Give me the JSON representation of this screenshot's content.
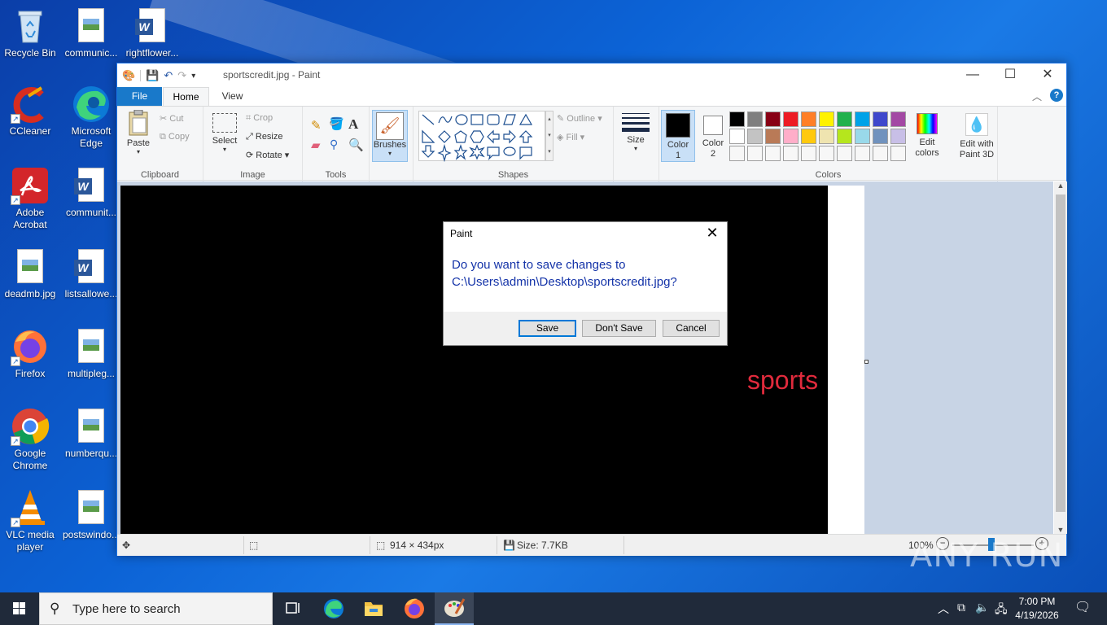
{
  "desktop": {
    "icons": [
      {
        "label": "Recycle Bin"
      },
      {
        "label": "communic..."
      },
      {
        "label": "rightflower..."
      },
      {
        "label": "CCleaner"
      },
      {
        "label": "Microsoft Edge"
      },
      {
        "label": "Adobe Acrobat"
      },
      {
        "label": "communit..."
      },
      {
        "label": "deadmb.jpg"
      },
      {
        "label": "listsallowe..."
      },
      {
        "label": "Firefox"
      },
      {
        "label": "multipleg..."
      },
      {
        "label": "Google Chrome"
      },
      {
        "label": "numberqu..."
      },
      {
        "label": "VLC media player"
      },
      {
        "label": "postswindo..."
      }
    ]
  },
  "paint": {
    "title": "sportscredit.jpg - Paint",
    "tabs": {
      "file": "File",
      "home": "Home",
      "view": "View"
    },
    "ribbon": {
      "clipboard": {
        "paste": "Paste",
        "cut": "Cut",
        "copy": "Copy",
        "label": "Clipboard"
      },
      "image": {
        "select": "Select",
        "crop": "Crop",
        "resize": "Resize",
        "rotate": "Rotate",
        "label": "Image"
      },
      "tools": {
        "label": "Tools"
      },
      "brushes": {
        "label": "Brushes"
      },
      "shapes": {
        "outline": "Outline",
        "fill": "Fill",
        "label": "Shapes"
      },
      "size": {
        "label": "Size"
      },
      "colors": {
        "color1": "Color 1",
        "color2": "Color 2",
        "edit_colors": "Edit colors",
        "edit_paint3d": "Edit with Paint 3D",
        "label": "Colors",
        "palette_row1": [
          "#000000",
          "#7f7f7f",
          "#880015",
          "#ed1c24",
          "#ff7f27",
          "#fff200",
          "#22b14c",
          "#00a2e8",
          "#3f48cc",
          "#a349a4"
        ],
        "palette_row2": [
          "#ffffff",
          "#c3c3c3",
          "#b97a57",
          "#ffaec9",
          "#ffc90e",
          "#efe4b0",
          "#b5e61d",
          "#99d9ea",
          "#7092be",
          "#c8bfe7"
        ]
      }
    },
    "canvas_text": "sports",
    "status": {
      "dimensions": "914 × 434px",
      "size": "Size: 7.7KB",
      "zoom": "100%"
    }
  },
  "dialog": {
    "title": "Paint",
    "message_line1": "Do you want to save changes to",
    "message_line2": "C:\\Users\\admin\\Desktop\\sportscredit.jpg?",
    "buttons": {
      "save": "Save",
      "dont_save": "Don't Save",
      "cancel": "Cancel"
    }
  },
  "taskbar": {
    "search_placeholder": "Type here to search",
    "time": "7:00 PM",
    "date": "4/19/2026"
  },
  "watermark": "ANY RUN"
}
